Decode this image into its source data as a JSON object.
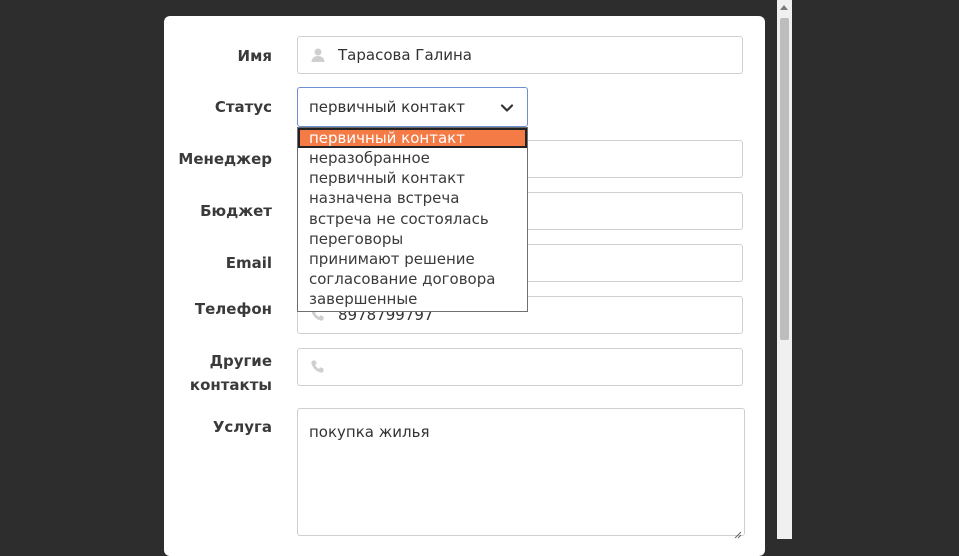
{
  "form": {
    "name": {
      "label": "Имя",
      "value": "Тарасова Галина",
      "icon": "user-icon"
    },
    "status": {
      "label": "Статус",
      "value": "первичный контакт"
    },
    "manager": {
      "label": "Менеджер"
    },
    "budget": {
      "label": "Бюджет"
    },
    "email": {
      "label": "Email"
    },
    "phone": {
      "label": "Телефон",
      "value": "8978799797",
      "icon": "phone-icon"
    },
    "other_contacts": {
      "label_line1": "Другие",
      "label_line2": "контакты",
      "value": "",
      "icon": "phone-icon"
    },
    "service": {
      "label": "Услуга",
      "value": "покупка жилья"
    }
  },
  "status_dropdown": {
    "options": [
      "первичный контакт",
      "неразобранное",
      "первичный контакт",
      "назначена встреча",
      "встреча не состоялась",
      "переговоры",
      "принимают решение",
      "согласование договора",
      "завершенные"
    ],
    "highlighted_index": 0
  },
  "colors": {
    "background": "#2d2d2d",
    "highlight": "#f47a46",
    "focus_border": "#6d8fd4"
  }
}
